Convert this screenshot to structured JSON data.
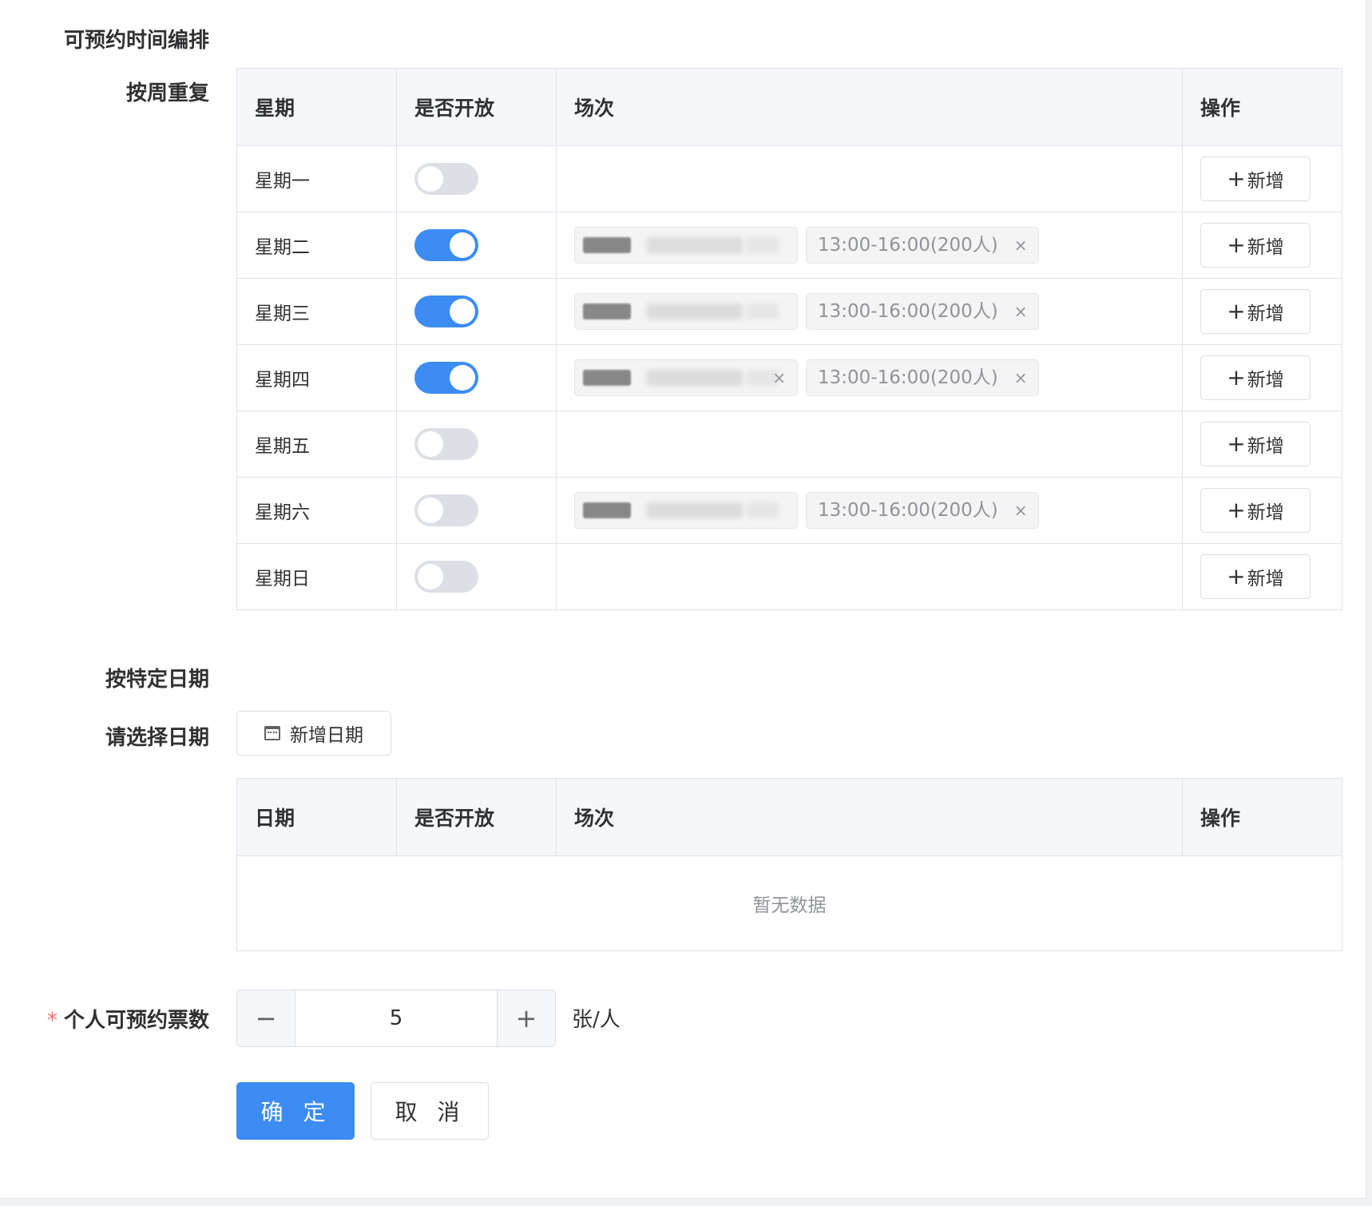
{
  "form": {
    "schedule_label": "可预约时间编排",
    "weekly_label": "按周重复",
    "specific_label": "按特定日期",
    "select_date_label": "请选择日期",
    "tickets_label": "个人可预约票数",
    "required_mark": "*"
  },
  "weekly_table": {
    "headers": [
      "星期",
      "是否开放",
      "场次",
      "操作"
    ],
    "rows": [
      {
        "day": "星期一",
        "open": false,
        "sessions": []
      },
      {
        "day": "星期二",
        "open": true,
        "sessions": [
          "(redacted)",
          "13:00-16:00(200人)"
        ]
      },
      {
        "day": "星期三",
        "open": true,
        "sessions": [
          "(redacted)",
          "13:00-16:00(200人)"
        ]
      },
      {
        "day": "星期四",
        "open": true,
        "sessions": [
          "(redacted)",
          "13:00-16:00(200人)"
        ]
      },
      {
        "day": "星期五",
        "open": false,
        "sessions": []
      },
      {
        "day": "星期六",
        "open": false,
        "sessions": [
          "(redacted)",
          "13:00-16:00(200人)"
        ]
      },
      {
        "day": "星期日",
        "open": false,
        "sessions": []
      }
    ],
    "add_label": "新增",
    "add_icon": "plus-icon",
    "close_icon": "close-icon",
    "close_glyph": "×",
    "plus_glyph": "+"
  },
  "add_date_button": {
    "label": "新增日期",
    "icon": "calendar-icon"
  },
  "date_table": {
    "headers": [
      "日期",
      "是否开放",
      "场次",
      "操作"
    ],
    "empty_text": "暂无数据"
  },
  "tickets": {
    "value": "5",
    "unit": "张/人",
    "minus_glyph": "−",
    "plus_glyph": "+"
  },
  "actions": {
    "confirm": "确 定",
    "cancel": "取 消"
  },
  "colors": {
    "primary": "#3c8cf4",
    "switch_off": "#dcdfe6",
    "required": "#f56c6c"
  }
}
